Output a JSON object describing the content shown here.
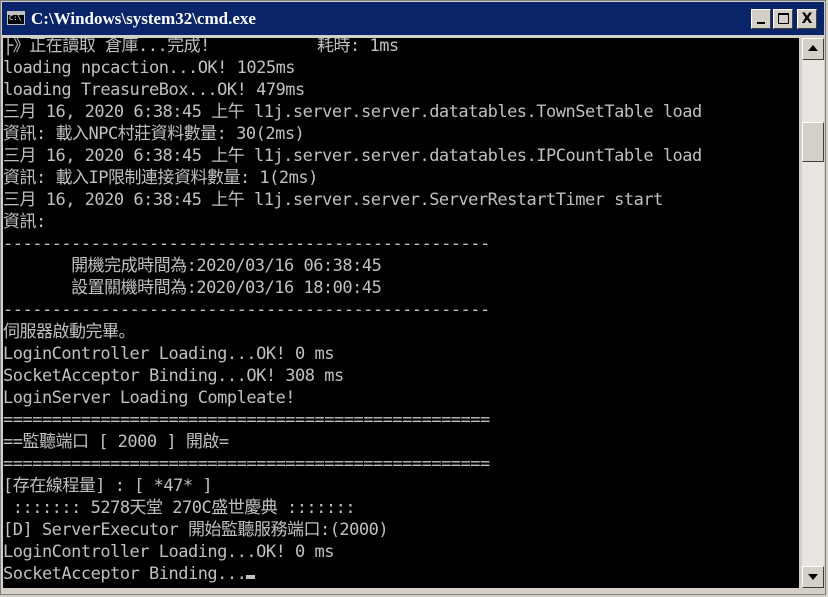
{
  "window": {
    "title": "C:\\Windows\\system32\\cmd.exe",
    "minimize_label": "_",
    "maximize_label": "□",
    "close_label": "X"
  },
  "colors": {
    "titlebar": "#0a246a",
    "console_bg": "#000000",
    "console_fg": "#c0c0c0"
  },
  "console": {
    "lines": [
      "├》正在讀取 倉庫...完成!           耗時: 1ms",
      "loading npcaction...OK! 1025ms",
      "loading TreasureBox...OK! 479ms",
      "三月 16, 2020 6:38:45 上午 l1j.server.server.datatables.TownSetTable load",
      "資訊: 載入NPC村莊資料數量: 30(2ms)",
      "三月 16, 2020 6:38:45 上午 l1j.server.server.datatables.IPCountTable load",
      "資訊: 載入IP限制連接資料數量: 1(2ms)",
      "三月 16, 2020 6:38:45 上午 l1j.server.server.ServerRestartTimer start",
      "資訊:",
      "--------------------------------------------------",
      "       開機完成時間為:2020/03/16 06:38:45",
      "       設置關機時間為:2020/03/16 18:00:45",
      "--------------------------------------------------",
      "伺服器啟動完畢。",
      "LoginController Loading...OK! 0 ms",
      "SocketAcceptor Binding...OK! 308 ms",
      "LoginServer Loading Compleate!",
      "==================================================",
      "==監聽端口 [ 2000 ] 開啟=",
      "==================================================",
      "[存在線程量] : [ *47* ]",
      " ::::::: 5278天堂 270C盛世慶典 :::::::",
      "[D] ServerExecutor 開始監聽服務端口:(2000)",
      "LoginController Loading...OK! 0 ms",
      "SocketAcceptor Binding..."
    ]
  },
  "scrollbar": {
    "up_icon": "scroll-up-arrow-icon",
    "down_icon": "scroll-down-arrow-icon"
  }
}
